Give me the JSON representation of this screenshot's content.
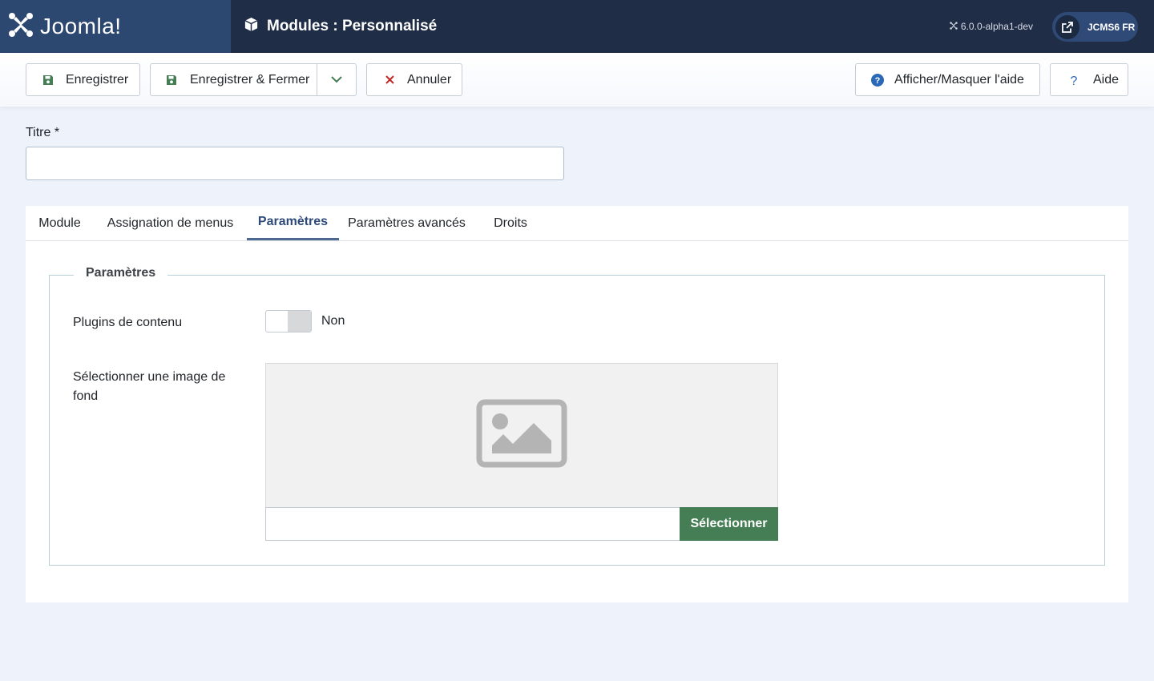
{
  "header": {
    "logo_text": "Joomla!",
    "page_title": "Modules : Personnalisé",
    "version": "6.0.0-alpha1-dev",
    "site_label": "JCMS6 FR"
  },
  "toolbar": {
    "save_label": "Enregistrer",
    "save_close_label": "Enregistrer & Fermer",
    "cancel_label": "Annuler",
    "toggle_help_label": "Afficher/Masquer l'aide",
    "help_label": "Aide"
  },
  "form": {
    "title_label": "Titre *",
    "title_value": ""
  },
  "tabs": [
    {
      "label": "Module",
      "active": false
    },
    {
      "label": "Assignation de menus",
      "active": false
    },
    {
      "label": "Paramètres",
      "active": true
    },
    {
      "label": "Paramètres avancés",
      "active": false
    },
    {
      "label": "Droits",
      "active": false
    }
  ],
  "params": {
    "legend": "Paramètres",
    "plugins_label": "Plugins de contenu",
    "plugins_value": "Non",
    "image_label": "Sélectionner une image de fond",
    "image_path": "",
    "select_button": "Sélectionner"
  },
  "colors": {
    "header_bg": "#1f2d47",
    "logo_bg": "#2c4770",
    "accent": "#2d4a7a",
    "select_button": "#457d54",
    "save_icon": "#457d54",
    "cancel_icon": "#c52827",
    "help_icon": "#2a69b8"
  }
}
